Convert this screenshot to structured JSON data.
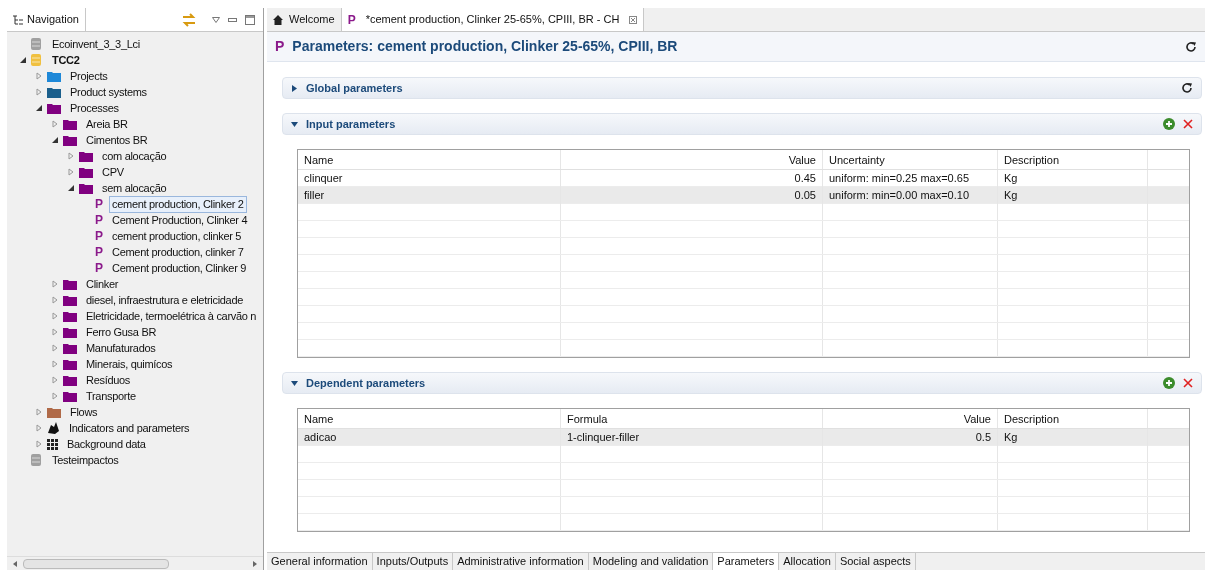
{
  "navigation": {
    "tab": "Navigation",
    "tree": [
      {
        "label": "Ecoinvent_3_3_Lci",
        "kind": "database",
        "color": "#a0a0a0",
        "selected": false
      },
      {
        "label": "TCC2",
        "kind": "database",
        "color": "#f0c040",
        "bold": true,
        "expanded": true,
        "selected": false,
        "children": [
          {
            "label": "Projects",
            "kind": "folder",
            "color": "#1e88d8",
            "expanded": false,
            "selected": false
          },
          {
            "label": "Product systems",
            "kind": "folder",
            "color": "#1b5f8c",
            "expanded": false,
            "selected": false
          },
          {
            "label": "Processes",
            "kind": "folder",
            "color": "#800080",
            "expanded": true,
            "selected": false,
            "children": [
              {
                "label": "Areia BR",
                "kind": "folder",
                "color": "#800080",
                "expanded": false,
                "selected": false
              },
              {
                "label": "Cimentos BR",
                "kind": "folder",
                "color": "#800080",
                "expanded": true,
                "selected": false,
                "children": [
                  {
                    "label": "com alocação",
                    "kind": "folder",
                    "color": "#800080",
                    "expanded": false,
                    "selected": false
                  },
                  {
                    "label": "CPV",
                    "kind": "folder",
                    "color": "#800080",
                    "expanded": false,
                    "selected": false
                  },
                  {
                    "label": "sem alocação",
                    "kind": "folder",
                    "color": "#800080",
                    "expanded": true,
                    "selected": false,
                    "children": [
                      {
                        "label": "cement production, Clinker 2",
                        "kind": "process",
                        "icon": "P",
                        "selected": true
                      },
                      {
                        "label": "Cement Production, Clinker 4",
                        "kind": "process",
                        "icon": "P",
                        "selected": false
                      },
                      {
                        "label": "cement production, clinker 5",
                        "kind": "process",
                        "icon": "P",
                        "selected": false
                      },
                      {
                        "label": "Cement production, clinker 7",
                        "kind": "process",
                        "icon": "P",
                        "selected": false
                      },
                      {
                        "label": "Cement production, Clinker 9",
                        "kind": "process",
                        "icon": "P",
                        "selected": false
                      }
                    ]
                  }
                ]
              },
              {
                "label": "Clinker",
                "kind": "folder",
                "color": "#800080",
                "expanded": false,
                "selected": false
              },
              {
                "label": "diesel, infraestrutura e eletricidade",
                "kind": "folder",
                "color": "#800080",
                "expanded": false,
                "selected": false
              },
              {
                "label": "Eletricidade, termoelétrica à carvão n",
                "kind": "folder",
                "color": "#800080",
                "expanded": false,
                "selected": false
              },
              {
                "label": "Ferro Gusa BR",
                "kind": "folder",
                "color": "#800080",
                "expanded": false,
                "selected": false
              },
              {
                "label": "Manufaturados",
                "kind": "folder",
                "color": "#800080",
                "expanded": false,
                "selected": false
              },
              {
                "label": "Minerais, quimícos",
                "kind": "folder",
                "color": "#800080",
                "expanded": false,
                "selected": false
              },
              {
                "label": "Resíduos",
                "kind": "folder",
                "color": "#800080",
                "expanded": false,
                "selected": false
              },
              {
                "label": "Transporte",
                "kind": "folder",
                "color": "#800080",
                "expanded": false,
                "selected": false
              }
            ]
          },
          {
            "label": "Flows",
            "kind": "folder",
            "color": "#b06a48",
            "expanded": false,
            "selected": false
          },
          {
            "label": "Indicators and parameters",
            "kind": "indicators",
            "expanded": false,
            "selected": false
          },
          {
            "label": "Background data",
            "kind": "background",
            "expanded": false,
            "selected": false
          }
        ]
      },
      {
        "label": "Testeimpactos",
        "kind": "database",
        "color": "#a0a0a0",
        "selected": false
      }
    ]
  },
  "editor_tabs": [
    {
      "label": "Welcome",
      "kind": "home",
      "selected": false
    },
    {
      "label": "*cement production, Clinker 25-65%, CPIII, BR - CH",
      "kind": "process",
      "icon": "P",
      "selected": true
    }
  ],
  "title": {
    "icon": "P",
    "text": "Parameters: cement production, Clinker 25-65%, CPIII, BR"
  },
  "sections": [
    {
      "title": "Global parameters",
      "expanded": false,
      "kind": "refresh"
    },
    {
      "title": "Input parameters",
      "expanded": true,
      "kind": "edit",
      "table": {
        "columns": [
          {
            "label": "Name",
            "numeric": false
          },
          {
            "label": "Value",
            "numeric": true
          },
          {
            "label": "Uncertainty",
            "numeric": false
          },
          {
            "label": "Description",
            "numeric": false
          }
        ],
        "rows": [
          {
            "cells": [
              "clinquer",
              "0.45",
              "uniform: min=0.25 max=0.65",
              "Kg"
            ],
            "selected": false
          },
          {
            "cells": [
              "filler",
              "0.05",
              "uniform: min=0.00 max=0.10",
              "Kg"
            ],
            "selected": true
          }
        ]
      }
    },
    {
      "title": "Dependent parameters",
      "expanded": true,
      "kind": "edit",
      "table": {
        "columns": [
          {
            "label": "Name",
            "numeric": false
          },
          {
            "label": "Formula",
            "numeric": false
          },
          {
            "label": "Value",
            "numeric": true
          },
          {
            "label": "Description",
            "numeric": false
          }
        ],
        "rows": [
          {
            "cells": [
              "adicao",
              "1-clinquer-filler",
              "0.5",
              "Kg"
            ],
            "selected": true
          }
        ]
      }
    }
  ],
  "page_tabs": [
    {
      "label": "General information",
      "selected": false
    },
    {
      "label": "Inputs/Outputs",
      "selected": false
    },
    {
      "label": "Administrative information",
      "selected": false
    },
    {
      "label": "Modeling and validation",
      "selected": false
    },
    {
      "label": "Parameters",
      "selected": true
    },
    {
      "label": "Allocation",
      "selected": false
    },
    {
      "label": "Social aspects",
      "selected": false
    }
  ]
}
